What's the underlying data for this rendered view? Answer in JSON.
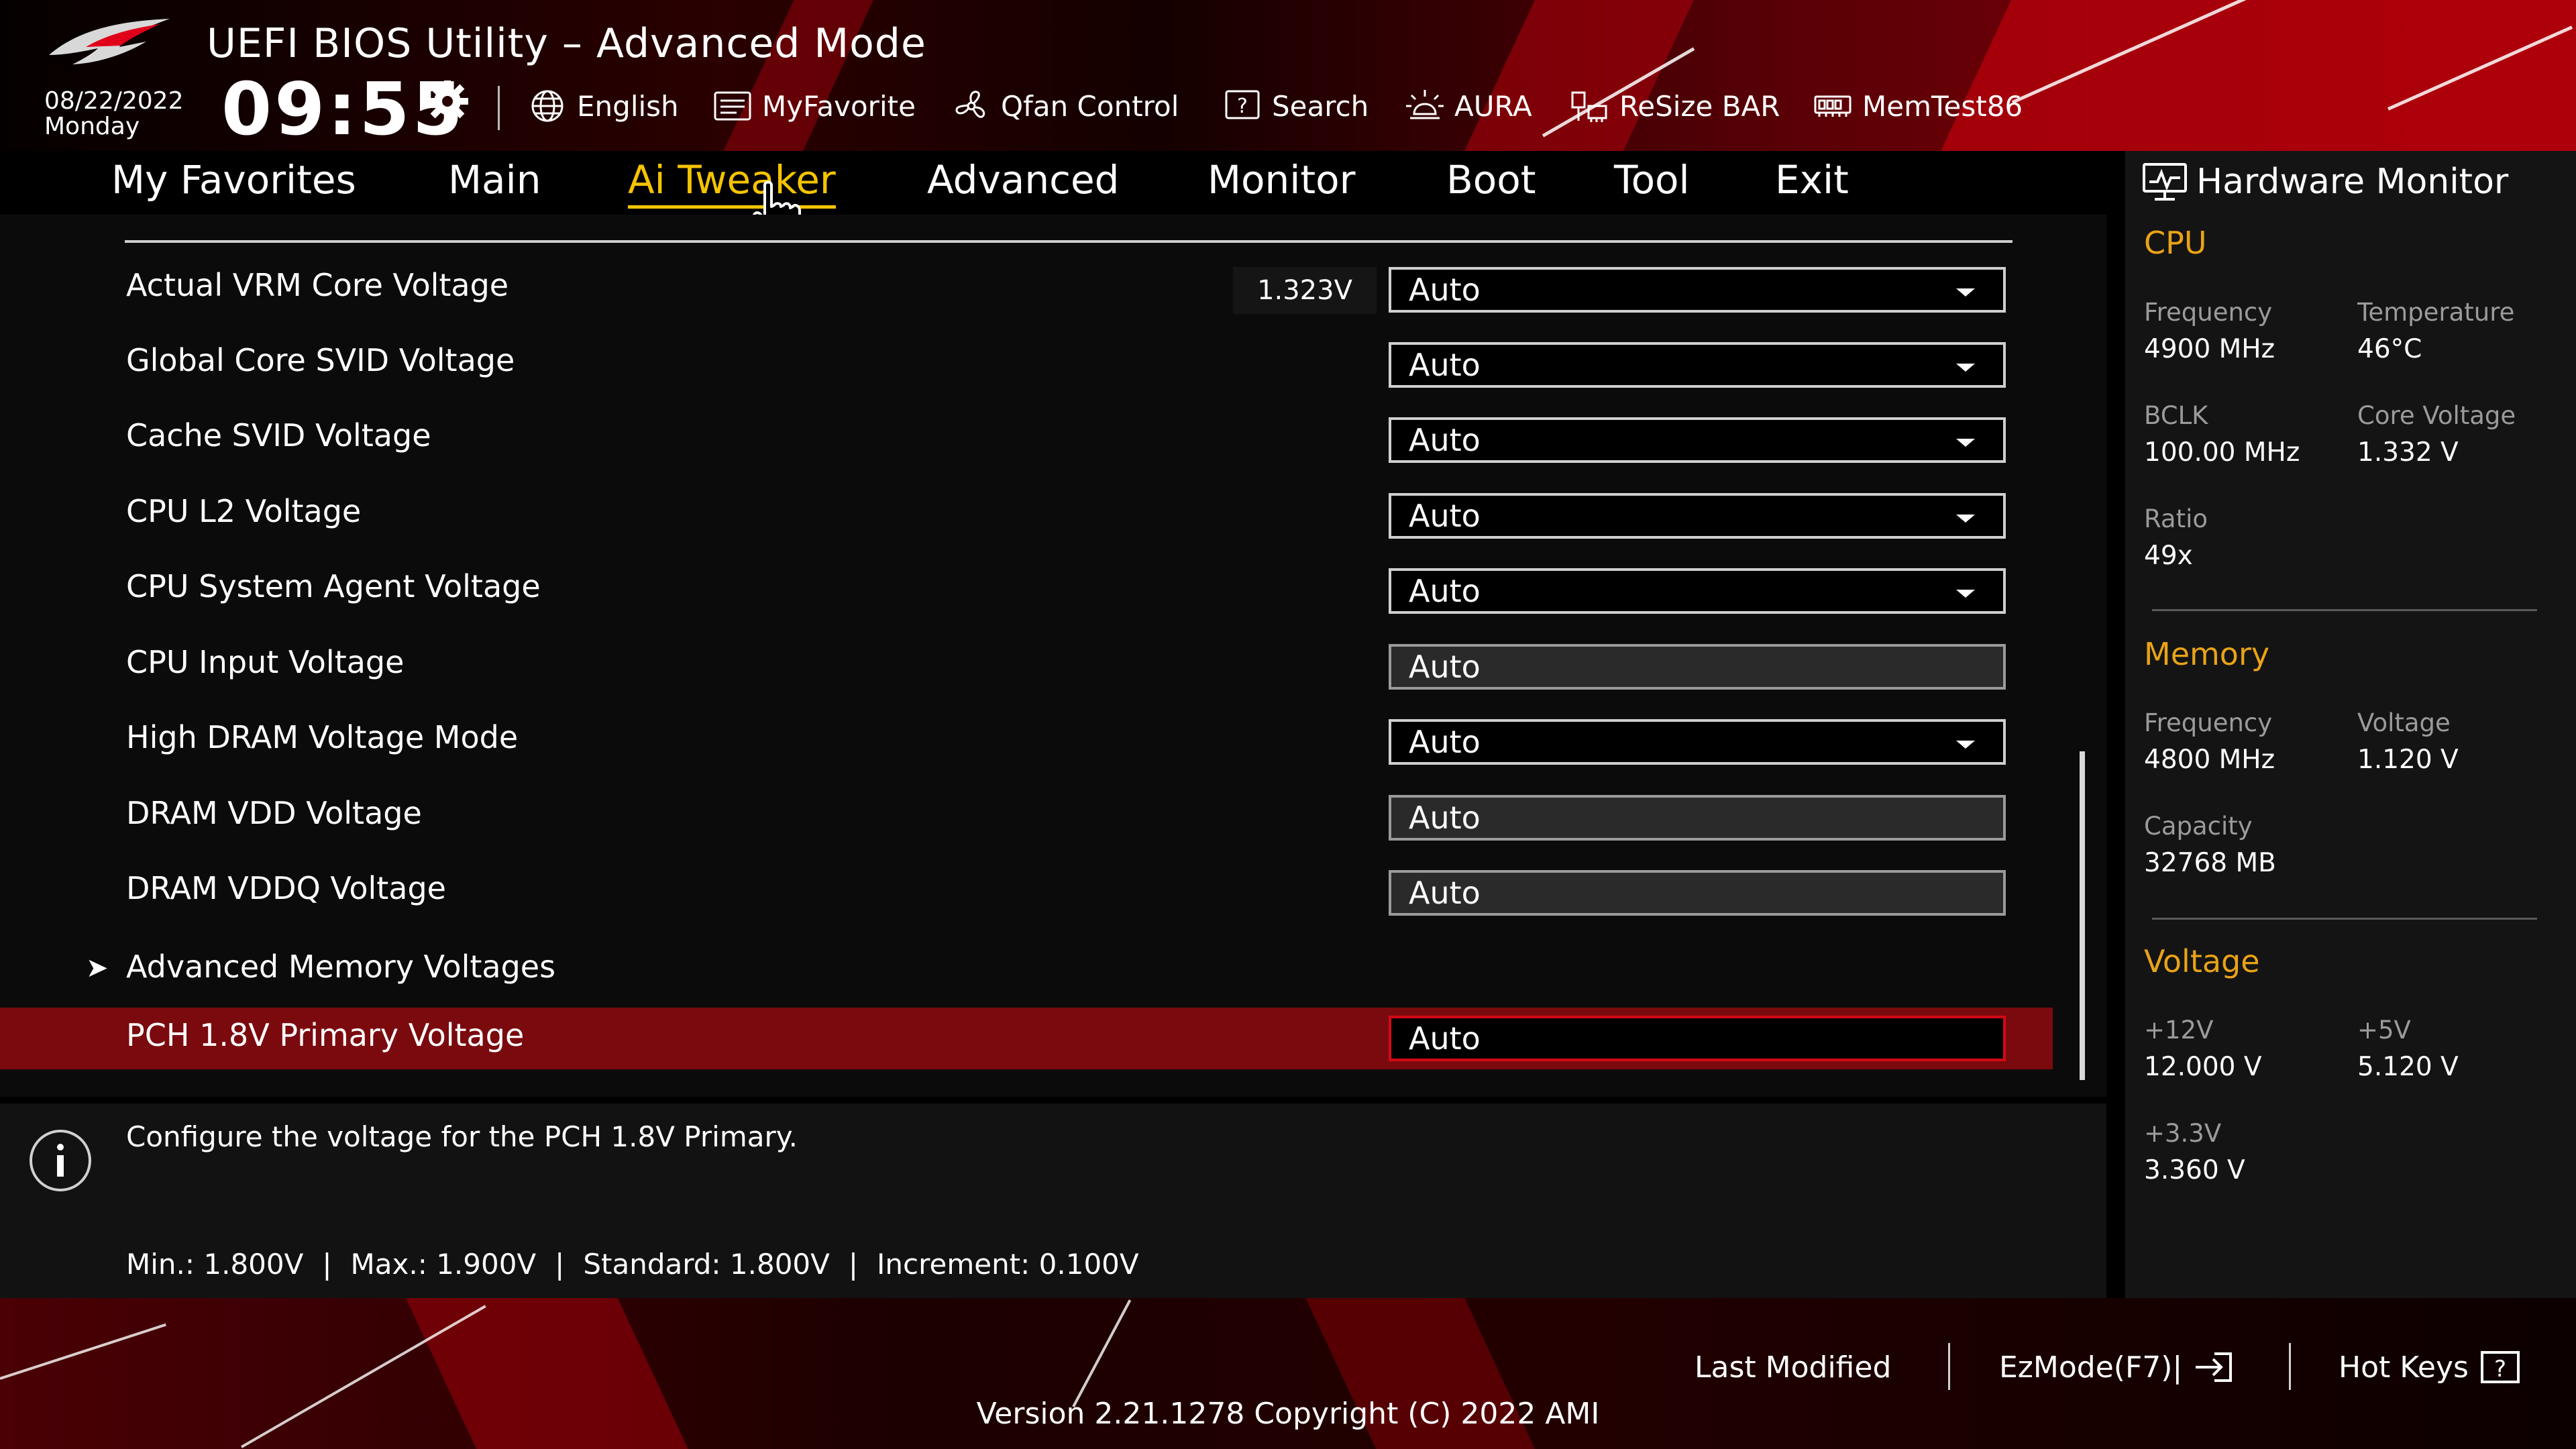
{
  "header": {
    "title": "UEFI BIOS Utility – Advanced Mode",
    "date": "08/22/2022",
    "day": "Monday",
    "time": "09:55",
    "tools": [
      {
        "label": "English",
        "icon": "globe-icon"
      },
      {
        "label": "MyFavorite",
        "icon": "favorite-list-icon"
      },
      {
        "label": "Qfan Control",
        "icon": "fan-icon"
      },
      {
        "label": "Search",
        "icon": "search-help-icon"
      },
      {
        "label": "AURA",
        "icon": "aura-light-icon"
      },
      {
        "label": "ReSize BAR",
        "icon": "resize-bar-icon"
      },
      {
        "label": "MemTest86",
        "icon": "memory-icon"
      }
    ]
  },
  "menu": {
    "items": [
      "My Favorites",
      "Main",
      "Ai Tweaker",
      "Advanced",
      "Monitor",
      "Boot",
      "Tool",
      "Exit"
    ],
    "active": "Ai Tweaker"
  },
  "settings": {
    "rows": [
      {
        "label": "Actual VRM Core Voltage",
        "current": "1.323V",
        "value": "Auto"
      },
      {
        "label": "Global Core SVID Voltage",
        "value": "Auto"
      },
      {
        "label": "Cache SVID Voltage",
        "value": "Auto"
      },
      {
        "label": "CPU L2 Voltage",
        "value": "Auto"
      },
      {
        "label": "CPU System Agent Voltage",
        "value": "Auto"
      },
      {
        "label": "CPU Input Voltage",
        "value": "Auto"
      },
      {
        "label": "High DRAM Voltage Mode",
        "value": "Auto"
      },
      {
        "label": "DRAM VDD Voltage",
        "value": "Auto"
      },
      {
        "label": "DRAM VDDQ Voltage",
        "value": "Auto"
      },
      {
        "label": "Advanced Memory Voltages",
        "submenu_glyph": "➤"
      },
      {
        "label": "PCH 1.8V Primary Voltage",
        "value": "Auto"
      }
    ],
    "selected_index": 10
  },
  "help": {
    "description": "Configure the voltage for the PCH 1.8V Primary.",
    "min": "Min.: 1.800V",
    "max": "Max.: 1.900V",
    "standard": "Standard: 1.800V",
    "increment": "Increment: 0.100V",
    "separator": "|"
  },
  "hardware_monitor": {
    "title": "Hardware Monitor",
    "cpu": {
      "heading": "CPU",
      "frequency_label": "Frequency",
      "frequency": "4900 MHz",
      "temperature_label": "Temperature",
      "temperature": "46°C",
      "bclk_label": "BCLK",
      "bclk": "100.00 MHz",
      "core_voltage_label": "Core Voltage",
      "core_voltage": "1.332 V",
      "ratio_label": "Ratio",
      "ratio": "49x"
    },
    "memory": {
      "heading": "Memory",
      "frequency_label": "Frequency",
      "frequency": "4800 MHz",
      "voltage_label": "Voltage",
      "voltage": "1.120 V",
      "capacity_label": "Capacity",
      "capacity": "32768 MB"
    },
    "voltage": {
      "heading": "Voltage",
      "v12_label": "+12V",
      "v12": "12.000 V",
      "v5_label": "+5V",
      "v5": "5.120 V",
      "v33_label": "+3.3V",
      "v33": "3.360 V"
    }
  },
  "footer": {
    "last_modified": "Last Modified",
    "ezmode": "EzMode(F7)|",
    "hot_keys": "Hot Keys",
    "version": "Version 2.21.1278 Copyright (C) 2022 AMI"
  },
  "colors": {
    "accent": "#f5c400",
    "section_heading": "#e9a317",
    "selected_row": "#7a0a0e"
  }
}
